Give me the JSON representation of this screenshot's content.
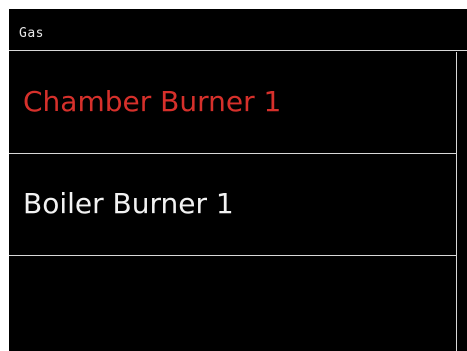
{
  "header": {
    "title": "Gas"
  },
  "list": {
    "items": [
      {
        "label": "Chamber Burner 1",
        "color": "#d6302b",
        "selected": true
      },
      {
        "label": "Boiler Burner 1",
        "color": "#f2f2f2",
        "selected": false
      },
      {
        "label": "",
        "color": "#f2f2f2",
        "selected": false
      }
    ]
  },
  "colors": {
    "background": "#000000",
    "divider": "#d8d8d8",
    "selected_text": "#d6302b",
    "text": "#f2f2f2"
  }
}
